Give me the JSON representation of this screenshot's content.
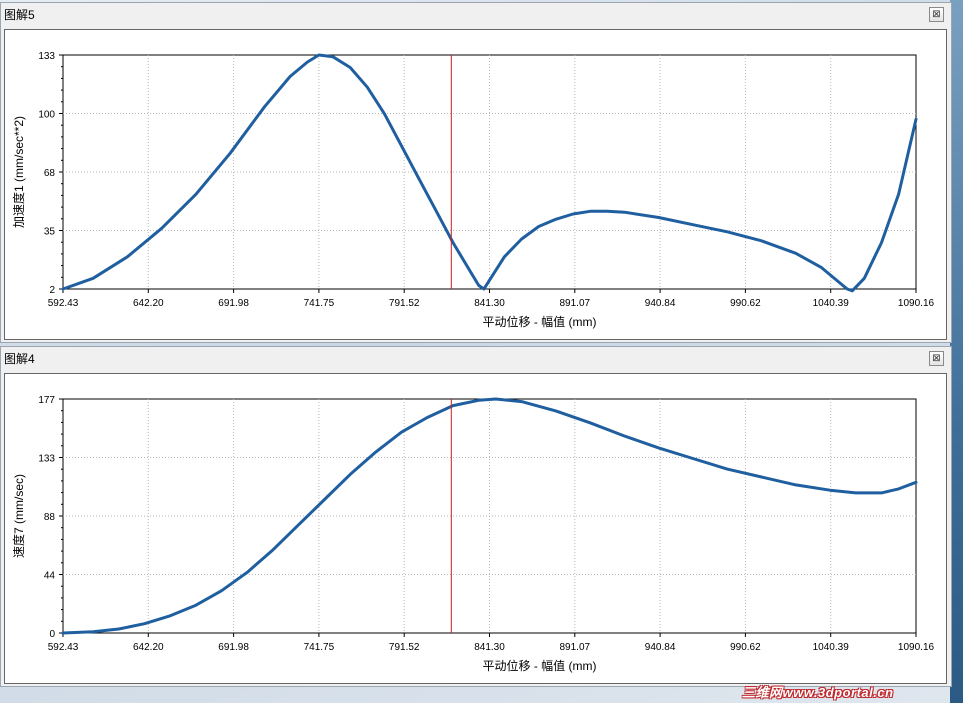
{
  "panels": [
    {
      "title": "图解5",
      "close_label": "⊠",
      "chart_data": {
        "type": "line",
        "title": "",
        "xlabel": "平动位移 - 幅值 (mm)",
        "ylabel": "加速度1 (mm/sec**2)",
        "xlim": [
          592.43,
          1090.16
        ],
        "ylim": [
          2,
          133
        ],
        "xticks": [
          "592.43",
          "642.20",
          "691.98",
          "741.75",
          "791.52",
          "841.30",
          "891.07",
          "940.84",
          "990.62",
          "1040.39",
          "1090.16"
        ],
        "yticks": [
          "2",
          "35",
          "68",
          "100",
          "133"
        ],
        "cursor_x": 819,
        "grid": true,
        "line_color": "#1f5fa0",
        "cursor_color": "#c81e1e",
        "x": [
          592.43,
          610,
          630,
          650,
          670,
          690,
          710,
          725,
          735,
          741.75,
          750,
          760,
          770,
          780,
          790,
          800,
          810,
          820,
          830,
          835,
          838,
          842,
          850,
          860,
          870,
          880,
          890,
          900,
          910,
          920,
          940,
          960,
          980,
          1000,
          1020,
          1035,
          1045,
          1050,
          1053,
          1060,
          1070,
          1080,
          1090.16
        ],
        "y": [
          2,
          8,
          20,
          36,
          55,
          78,
          104,
          121,
          129,
          133,
          132,
          126,
          115,
          100,
          82,
          64,
          46,
          28,
          12,
          4,
          2,
          8,
          20,
          30,
          37,
          41,
          44,
          45.5,
          45.5,
          45,
          42,
          38,
          34,
          29,
          22,
          14,
          6,
          2,
          1,
          8,
          28,
          55,
          97
        ]
      }
    },
    {
      "title": "图解4",
      "close_label": "⊠",
      "chart_data": {
        "type": "line",
        "title": "",
        "xlabel": "平动位移 - 幅值 (mm)",
        "ylabel": "速度7 (mm/sec)",
        "xlim": [
          592.43,
          1090.16
        ],
        "ylim": [
          0,
          177
        ],
        "xticks": [
          "592.43",
          "642.20",
          "691.98",
          "741.75",
          "791.52",
          "841.30",
          "891.07",
          "940.84",
          "990.62",
          "1040.39",
          "1090.16"
        ],
        "yticks": [
          "0",
          "44",
          "88",
          "133",
          "177"
        ],
        "cursor_x": 819,
        "grid": true,
        "line_color": "#1f5fa0",
        "cursor_color": "#c81e1e",
        "x": [
          592.43,
          610,
          625,
          640,
          655,
          670,
          685,
          700,
          715,
          730,
          745,
          760,
          775,
          790,
          805,
          820,
          835,
          845,
          860,
          880,
          900,
          920,
          940,
          960,
          980,
          1000,
          1020,
          1040,
          1055,
          1070,
          1080,
          1090.16
        ],
        "y": [
          0,
          1,
          3,
          7,
          13,
          21,
          32,
          46,
          63,
          82,
          101,
          120,
          137,
          152,
          163,
          172,
          176,
          177,
          175,
          168,
          159,
          149,
          140,
          132,
          124,
          118,
          112,
          108,
          106,
          106,
          109,
          114
        ]
      }
    }
  ],
  "watermark": "三维网www.3dportal.cn"
}
